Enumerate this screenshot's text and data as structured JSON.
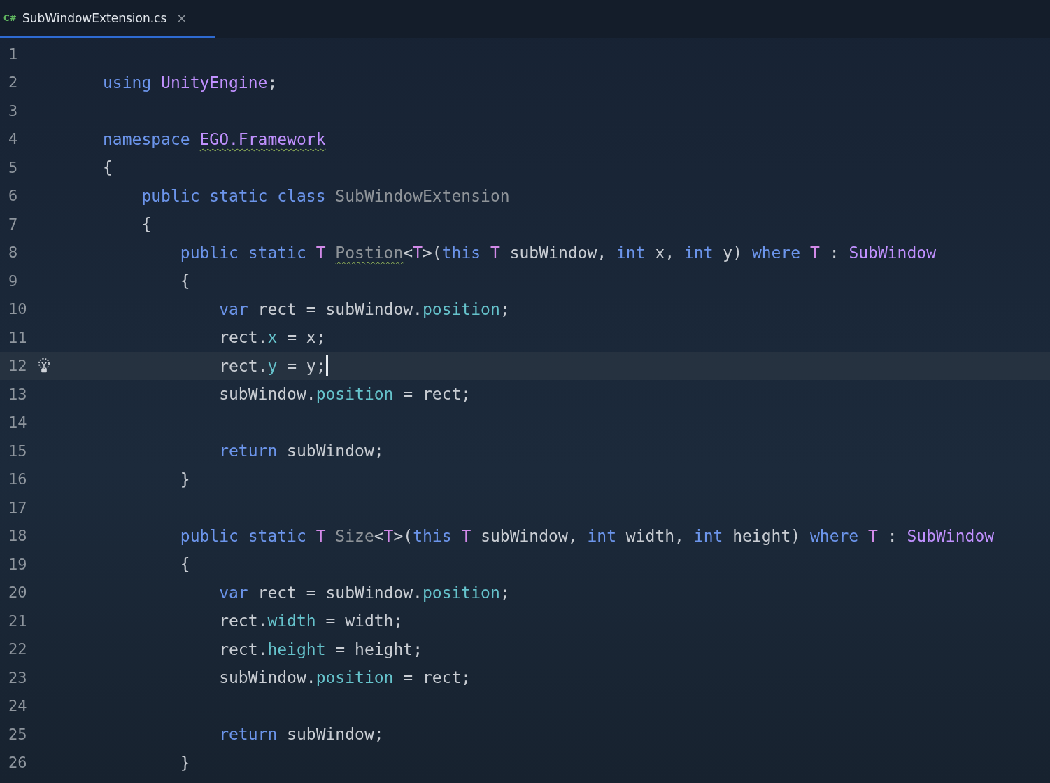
{
  "tab": {
    "language_badge": "C#",
    "filename": "SubWindowExtension.cs",
    "close": "×",
    "selected": true
  },
  "lines": [
    {
      "number": "1",
      "current": false
    },
    {
      "number": "2",
      "current": false,
      "tokens": [
        {
          "text": "using ",
          "kind": "keyword"
        },
        {
          "text": "UnityEngine",
          "kind": "type"
        },
        {
          "text": ";",
          "kind": "plain"
        }
      ]
    },
    {
      "number": "3",
      "current": false
    },
    {
      "number": "4",
      "current": false,
      "tokens": [
        {
          "text": "namespace ",
          "kind": "keyword"
        },
        {
          "text": "EGO.Framework",
          "kind": "type",
          "warning": true
        }
      ]
    },
    {
      "number": "5",
      "current": false,
      "tokens": [
        {
          "text": "{",
          "kind": "plain"
        }
      ]
    },
    {
      "number": "6",
      "current": false,
      "tokens": [
        {
          "text": "    public static class ",
          "kind": "keyword"
        },
        {
          "text": "SubWindowExtension",
          "kind": "unused"
        }
      ]
    },
    {
      "number": "7",
      "current": false,
      "tokens": [
        {
          "text": "    {",
          "kind": "plain"
        }
      ]
    },
    {
      "number": "8",
      "current": false,
      "tokens": [
        {
          "text": "        public static ",
          "kind": "keyword"
        },
        {
          "text": "T ",
          "kind": "typeparam"
        },
        {
          "text": "Postion",
          "kind": "unused",
          "warning": true
        },
        {
          "text": "<",
          "kind": "plain"
        },
        {
          "text": "T",
          "kind": "typeparam"
        },
        {
          "text": ">(",
          "kind": "plain"
        },
        {
          "text": "this ",
          "kind": "keyword"
        },
        {
          "text": "T",
          "kind": "typeparam"
        },
        {
          "text": " subWindow, ",
          "kind": "plain"
        },
        {
          "text": "int",
          "kind": "keyword"
        },
        {
          "text": " x, ",
          "kind": "plain"
        },
        {
          "text": "int",
          "kind": "keyword"
        },
        {
          "text": " y) ",
          "kind": "plain"
        },
        {
          "text": "where ",
          "kind": "keyword"
        },
        {
          "text": "T",
          "kind": "typeparam"
        },
        {
          "text": " : ",
          "kind": "plain"
        },
        {
          "text": "SubWindow",
          "kind": "type"
        }
      ]
    },
    {
      "number": "9",
      "current": false,
      "tokens": [
        {
          "text": "        {",
          "kind": "plain"
        }
      ]
    },
    {
      "number": "10",
      "current": false,
      "tokens": [
        {
          "text": "            var",
          "kind": "keyword"
        },
        {
          "text": " rect = subWindow.",
          "kind": "plain"
        },
        {
          "text": "position",
          "kind": "field"
        },
        {
          "text": ";",
          "kind": "plain"
        }
      ]
    },
    {
      "number": "11",
      "current": false,
      "tokens": [
        {
          "text": "            rect.",
          "kind": "plain"
        },
        {
          "text": "x",
          "kind": "field"
        },
        {
          "text": " = x;",
          "kind": "plain"
        }
      ]
    },
    {
      "number": "12",
      "current": true,
      "tokens": [
        {
          "text": "            rect.",
          "kind": "plain"
        },
        {
          "text": "y",
          "kind": "field"
        },
        {
          "text": " = y;",
          "kind": "plain"
        }
      ]
    },
    {
      "number": "13",
      "current": false,
      "tokens": [
        {
          "text": "            subWindow.",
          "kind": "plain"
        },
        {
          "text": "position",
          "kind": "field"
        },
        {
          "text": " = rect;",
          "kind": "plain"
        }
      ]
    },
    {
      "number": "14",
      "current": false
    },
    {
      "number": "15",
      "current": false,
      "tokens": [
        {
          "text": "            return",
          "kind": "keyword"
        },
        {
          "text": " subWindow;",
          "kind": "plain"
        }
      ]
    },
    {
      "number": "16",
      "current": false,
      "tokens": [
        {
          "text": "        }",
          "kind": "plain"
        }
      ]
    },
    {
      "number": "17",
      "current": false
    },
    {
      "number": "18",
      "current": false,
      "tokens": [
        {
          "text": "        public static ",
          "kind": "keyword"
        },
        {
          "text": "T ",
          "kind": "typeparam"
        },
        {
          "text": "Size",
          "kind": "unused"
        },
        {
          "text": "<",
          "kind": "plain"
        },
        {
          "text": "T",
          "kind": "typeparam"
        },
        {
          "text": ">(",
          "kind": "plain"
        },
        {
          "text": "this ",
          "kind": "keyword"
        },
        {
          "text": "T",
          "kind": "typeparam"
        },
        {
          "text": " subWindow, ",
          "kind": "plain"
        },
        {
          "text": "int",
          "kind": "keyword"
        },
        {
          "text": " width, ",
          "kind": "plain"
        },
        {
          "text": "int",
          "kind": "keyword"
        },
        {
          "text": " height) ",
          "kind": "plain"
        },
        {
          "text": "where ",
          "kind": "keyword"
        },
        {
          "text": "T",
          "kind": "typeparam"
        },
        {
          "text": " : ",
          "kind": "plain"
        },
        {
          "text": "SubWindow",
          "kind": "type"
        }
      ]
    },
    {
      "number": "19",
      "current": false,
      "tokens": [
        {
          "text": "        {",
          "kind": "plain"
        }
      ]
    },
    {
      "number": "20",
      "current": false,
      "tokens": [
        {
          "text": "            var",
          "kind": "keyword"
        },
        {
          "text": " rect = subWindow.",
          "kind": "plain"
        },
        {
          "text": "position",
          "kind": "field"
        },
        {
          "text": ";",
          "kind": "plain"
        }
      ]
    },
    {
      "number": "21",
      "current": false,
      "tokens": [
        {
          "text": "            rect.",
          "kind": "plain"
        },
        {
          "text": "width",
          "kind": "field"
        },
        {
          "text": " = width;",
          "kind": "plain"
        }
      ]
    },
    {
      "number": "22",
      "current": false,
      "tokens": [
        {
          "text": "            rect.",
          "kind": "plain"
        },
        {
          "text": "height",
          "kind": "field"
        },
        {
          "text": " = height;",
          "kind": "plain"
        }
      ]
    },
    {
      "number": "23",
      "current": false,
      "tokens": [
        {
          "text": "            subWindow.",
          "kind": "plain"
        },
        {
          "text": "position",
          "kind": "field"
        },
        {
          "text": " = rect;",
          "kind": "plain"
        }
      ]
    },
    {
      "number": "24",
      "current": false
    },
    {
      "number": "25",
      "current": false,
      "tokens": [
        {
          "text": "            return",
          "kind": "keyword"
        },
        {
          "text": " subWindow;",
          "kind": "plain"
        }
      ]
    },
    {
      "number": "26",
      "current": false,
      "tokens": [
        {
          "text": "        }",
          "kind": "plain"
        }
      ]
    }
  ]
}
